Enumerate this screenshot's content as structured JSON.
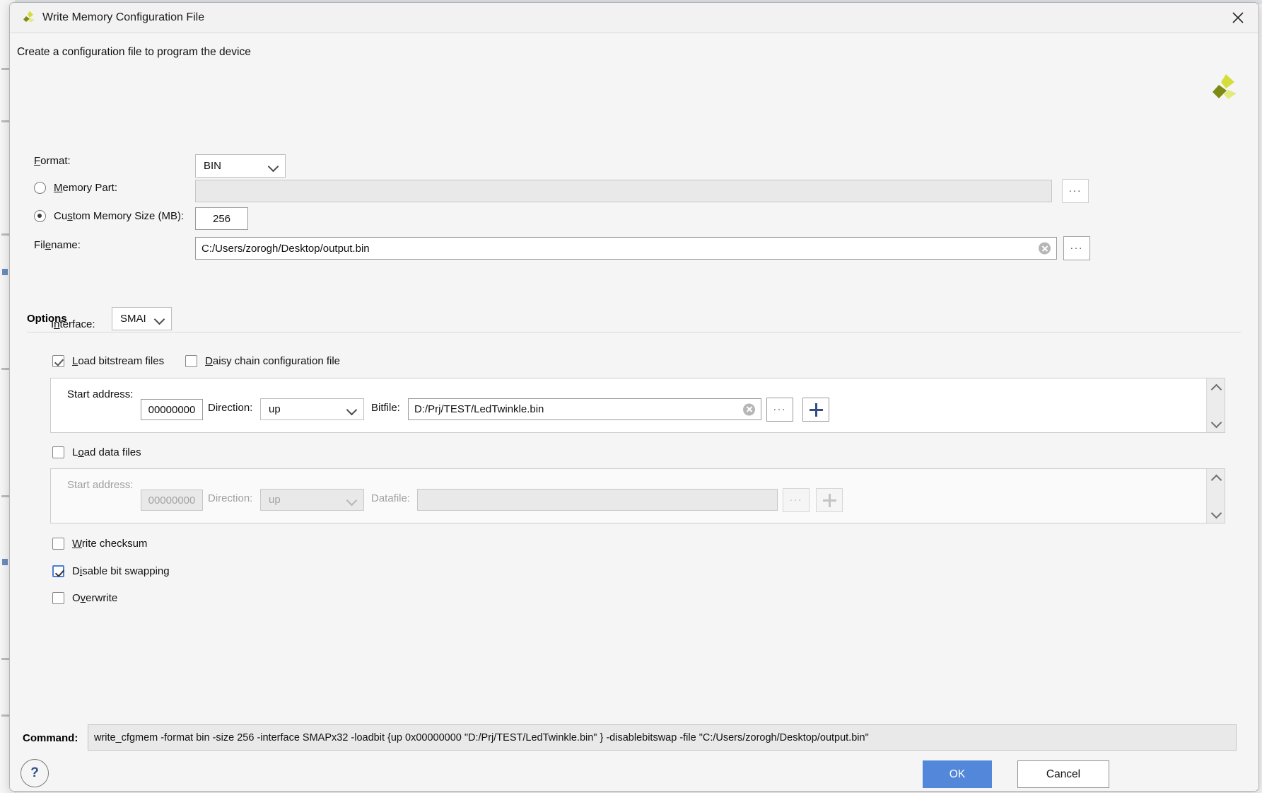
{
  "window": {
    "title": "Write Memory Configuration File",
    "app_icon": "vivado-logo-icon",
    "close_icon": "close-icon"
  },
  "subtitle": "Create a configuration file to program the device",
  "brand_logo": "amd-xilinx-logo-icon",
  "form": {
    "format": {
      "label": "Format:",
      "mnemonic": "F",
      "value": "BIN"
    },
    "memory_part": {
      "label": "Memory Part:",
      "mnemonic": "M",
      "selected": false,
      "value": "",
      "browse_label": "..."
    },
    "custom_memory_size": {
      "label": "Custom Memory Size (MB):",
      "mnemonic": "s",
      "selected": true,
      "value": "256"
    },
    "filename": {
      "label": "Filename:",
      "mnemonic": "e",
      "value": "C:/Users/zorogh/Desktop/output.bin",
      "clear_icon": "clear-circle-icon",
      "browse_label": "..."
    }
  },
  "options": {
    "title": "Options",
    "interface": {
      "label": "Interface:",
      "mnemonic": "n",
      "value": "SMAI"
    },
    "load_bitstream_files": {
      "label": "Load bitstream files",
      "mnemonic": "L",
      "checked": true
    },
    "daisy_chain": {
      "label": "Daisy chain configuration file",
      "mnemonic": "D",
      "checked": false
    },
    "bitstream_row": {
      "start_address_label": "Start address:",
      "start_address_value": "00000000",
      "direction_label": "Direction:",
      "direction_value": "up",
      "file_label": "Bitfile:",
      "file_value": "D:/Prj/TEST/LedTwinkle.bin",
      "clear_icon": "clear-circle-icon",
      "browse_label": "...",
      "add_icon": "plus-icon",
      "scroll_up_icon": "chevron-up-icon",
      "scroll_down_icon": "chevron-down-icon"
    },
    "load_data_files": {
      "label": "Load data files",
      "mnemonic": "o",
      "checked": false
    },
    "data_row": {
      "start_address_label": "Start address:",
      "start_address_value": "00000000",
      "direction_label": "Direction:",
      "direction_value": "up",
      "file_label": "Datafile:",
      "file_value": "",
      "browse_label": "...",
      "add_icon": "plus-icon",
      "scroll_up_icon": "chevron-up-icon",
      "scroll_down_icon": "chevron-down-icon"
    },
    "write_checksum": {
      "label": "Write checksum",
      "mnemonic": "W",
      "checked": false
    },
    "disable_bit_swapping": {
      "label": "Disable bit swapping",
      "mnemonic": "i",
      "checked": true,
      "focused": true
    },
    "overwrite": {
      "label": "Overwrite",
      "mnemonic": "v",
      "checked": false
    }
  },
  "command": {
    "label": "Command:",
    "value": "write_cfgmem  -format bin -size 256 -interface SMAPx32 -loadbit {up 0x00000000 \"D:/Prj/TEST/LedTwinkle.bin\" } -disablebitswap -file \"C:/Users/zorogh/Desktop/output.bin\""
  },
  "footer": {
    "help_label": "?",
    "ok_label": "OK",
    "cancel_label": "Cancel"
  },
  "colors": {
    "accent_blue": "#5287da",
    "plus_blue": "#2f4f86",
    "logo_green": "#d6e03a",
    "dialog_bg": "#f5f5f5"
  }
}
